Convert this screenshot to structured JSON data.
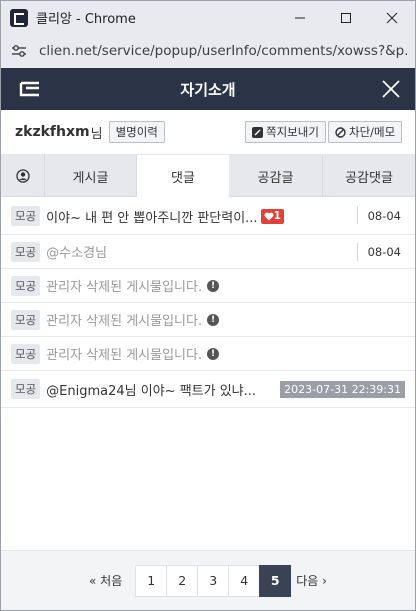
{
  "window": {
    "title": "클리앙 - Chrome",
    "minimize": "—",
    "maximize": "▢",
    "close": "✕"
  },
  "address": {
    "url": "clien.net/service/popup/userInfo/comments/xowss?&p..."
  },
  "popup": {
    "title": "자기소개"
  },
  "user": {
    "name": "zkzkfhxm",
    "suffix": "님",
    "history_label": "별명이력",
    "message_label": "쪽지보내기",
    "block_label": "차단/메모"
  },
  "tabs": [
    {
      "label": "게시글"
    },
    {
      "label": "댓글"
    },
    {
      "label": "공감글"
    },
    {
      "label": "공감댓글"
    }
  ],
  "comments": [
    {
      "board": "모공",
      "text": "이야~ 내 편 안 뽑아주니깐 판단력이...",
      "likes": "1",
      "date": "08-04"
    },
    {
      "board": "모공",
      "text": "@수소경님",
      "date": "08-04"
    },
    {
      "board": "모공",
      "text": "관리자 삭제된 게시물입니다."
    },
    {
      "board": "모공",
      "text": "관리자 삭제된 게시물입니다."
    },
    {
      "board": "모공",
      "text": "관리자 삭제된 게시물입니다."
    },
    {
      "board": "모공",
      "text": "@Enigma24님 이야~ 팩트가 있냐...",
      "date": "2023-07-31 22:39:31"
    }
  ],
  "pagination": {
    "prev": "« 처음",
    "next": "다음 ›",
    "pages": [
      "1",
      "2",
      "3",
      "4",
      "5"
    ],
    "current": "5"
  },
  "colors": {
    "header_bg": "#2b3347",
    "active_page": "#3a4255",
    "like_badge": "#e2413a"
  }
}
